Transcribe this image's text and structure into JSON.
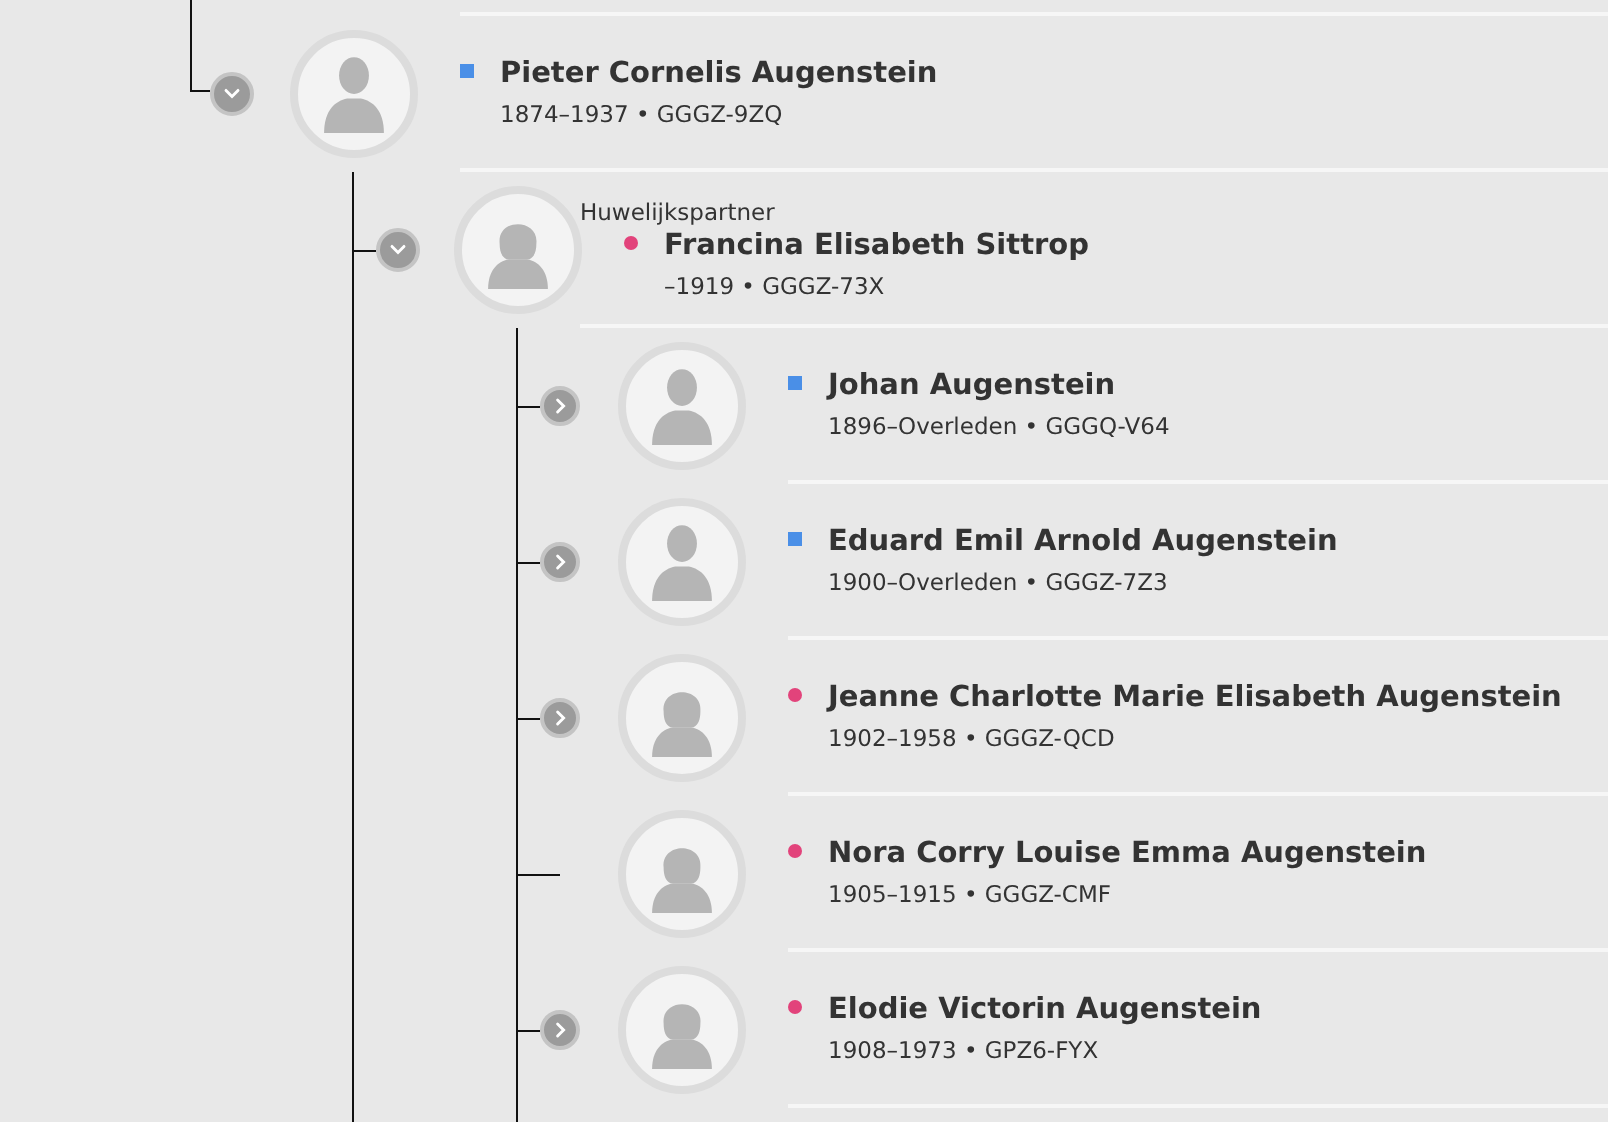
{
  "root": {
    "name": "Pieter Cornelis Augenstein",
    "details": "1874–1937 • GGGZ-9ZQ",
    "kind": "male",
    "expandable": true,
    "expanded": true,
    "spouse": {
      "label": "Huwelijkspartner",
      "name": "Francina Elisabeth Sittrop",
      "details": "–1919 • GGGZ-73X",
      "kind": "female",
      "expandable": true,
      "expanded": true,
      "children": [
        {
          "name": "Johan Augenstein",
          "details": "1896–Overleden • GGGQ-V64",
          "kind": "male",
          "expandable": true,
          "expanded": false
        },
        {
          "name": "Eduard Emil Arnold Augenstein",
          "details": "1900–Overleden • GGGZ-7Z3",
          "kind": "male",
          "expandable": true,
          "expanded": false
        },
        {
          "name": "Jeanne Charlotte Marie Elisabeth Augenstein",
          "details": "1902–1958 • GGGZ-QCD",
          "kind": "female",
          "expandable": true,
          "expanded": false
        },
        {
          "name": "Nora Corry Louise Emma Augenstein",
          "details": "1905–1915 • GGGZ-CMF",
          "kind": "female",
          "expandable": false
        },
        {
          "name": "Elodie Victorin Augenstein",
          "details": "1908–1973 • GPZ6-FYX",
          "kind": "female",
          "expandable": true,
          "expanded": false
        }
      ]
    }
  }
}
